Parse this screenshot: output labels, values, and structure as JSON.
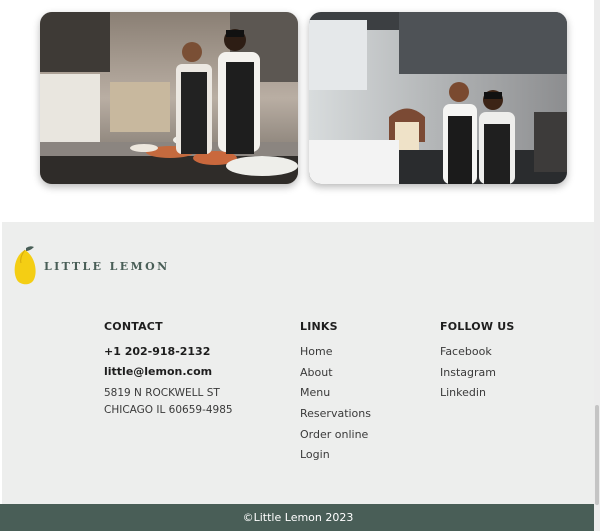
{
  "colors": {
    "brand_green": "#495e57",
    "footer_bg": "#edeeed",
    "lemon_yellow": "#f4ce14"
  },
  "gallery": {
    "images": [
      {
        "icon": "photo-two-chefs-prep-kitchen"
      },
      {
        "icon": "photo-two-chefs-laughing"
      }
    ]
  },
  "brand": {
    "logo_icon": "lemon-icon",
    "name": "LITTLE LEMON"
  },
  "footer": {
    "contact": {
      "title": "CONTACT",
      "phone": "+1 202-918-2132",
      "email": "little@lemon.com",
      "address_line1": "5819 N ROCKWELL ST",
      "address_line2": "CHICAGO IL 60659-4985"
    },
    "links": {
      "title": "LINKS",
      "items": [
        "Home",
        "About",
        "Menu",
        "Reservations",
        "Order online",
        "Login"
      ]
    },
    "follow": {
      "title": "FOLLOW US",
      "items": [
        "Facebook",
        "Instagram",
        "Linkedin"
      ]
    },
    "copyright": "©Little Lemon 2023"
  }
}
